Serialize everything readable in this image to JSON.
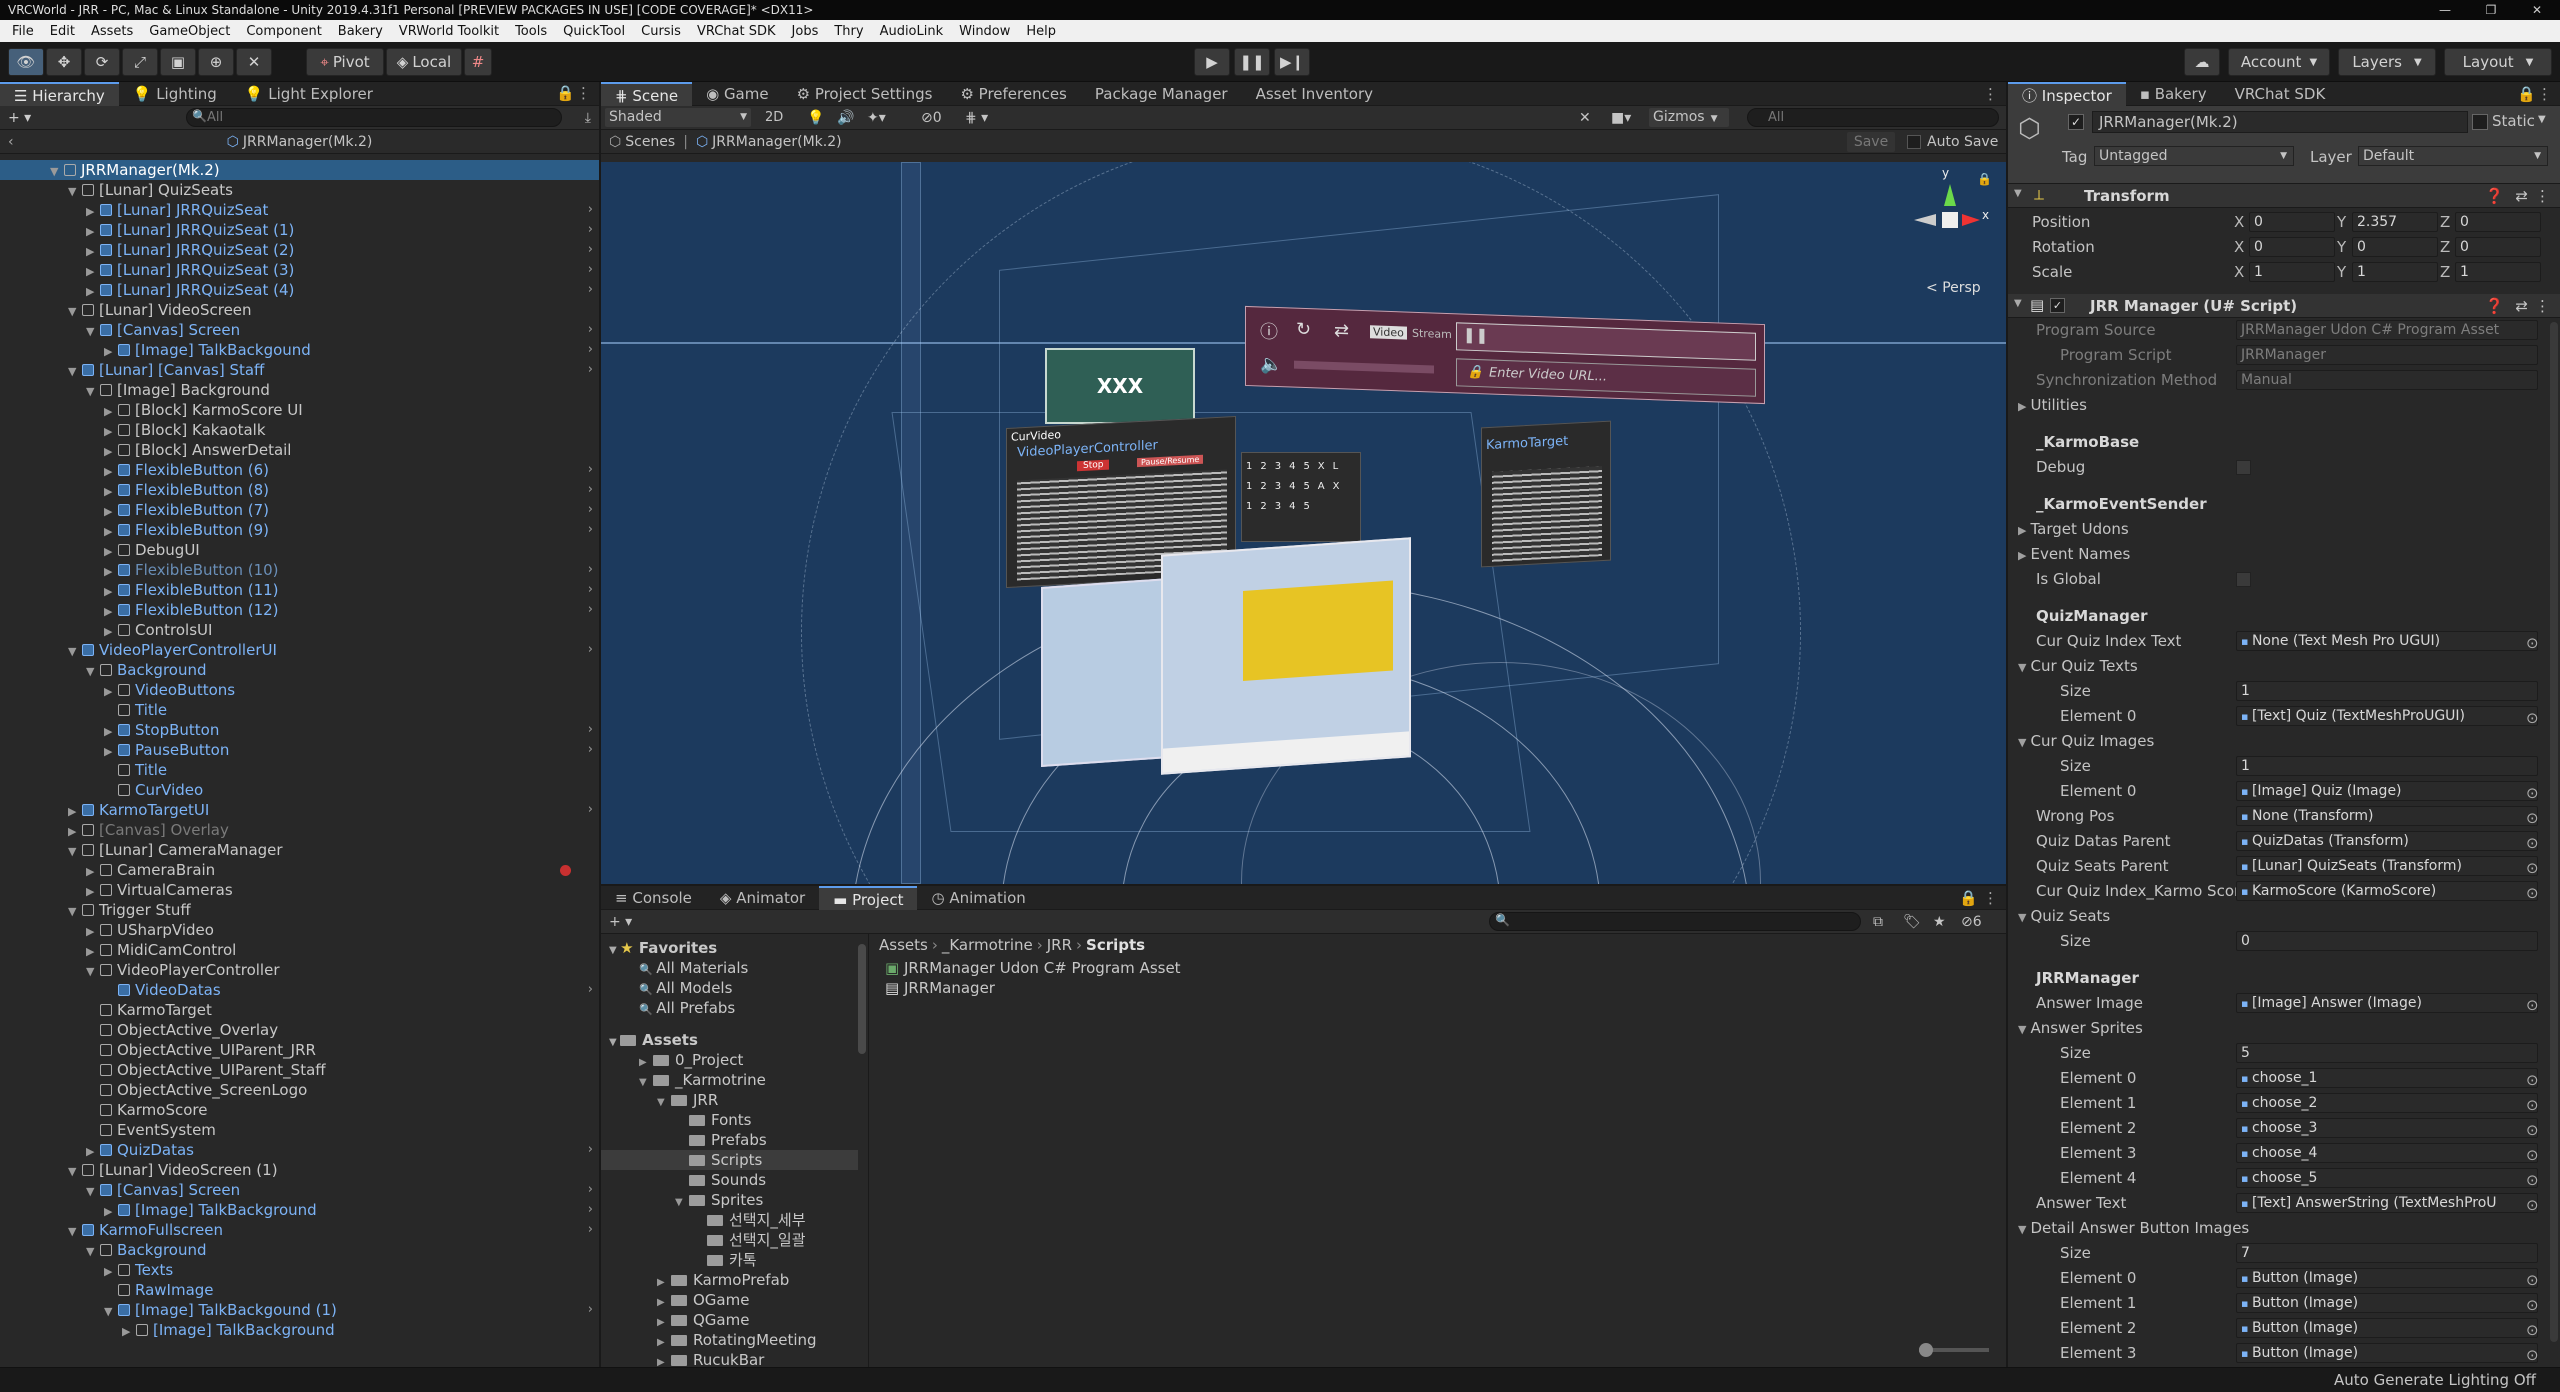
{
  "window": {
    "title": "VRCWorld - JRR - PC, Mac & Linux Standalone - Unity 2019.4.31f1 Personal [PREVIEW PACKAGES IN USE] [CODE COVERAGE]* <DX11>"
  },
  "menu": [
    "File",
    "Edit",
    "Assets",
    "GameObject",
    "Component",
    "Bakery",
    "VRWorld Toolkit",
    "Tools",
    "QuickTool",
    "Cursis",
    "VRChat SDK",
    "Jobs",
    "Thry",
    "AudioLink",
    "Window",
    "Help"
  ],
  "toolbar": {
    "pivot": "Pivot",
    "local": "Local",
    "account": "Account",
    "layers": "Layers",
    "layout": "Layout"
  },
  "hierarchy": {
    "tab_hierarchy": "Hierarchy",
    "tab_lighting": "Lighting",
    "tab_light_explorer": "Light Explorer",
    "search_placeholder": "All",
    "root": "JRRManager(Mk.2)",
    "rows": [
      {
        "label": "JRRManager(Mk.2)",
        "depth": 0,
        "style": "sel",
        "arrow": "▼",
        "icon": "cube"
      },
      {
        "label": "[Lunar] QuizSeats",
        "depth": 1,
        "style": "",
        "arrow": "▼",
        "icon": "cube"
      },
      {
        "label": "[Lunar] JRRQuizSeat",
        "depth": 2,
        "style": "blue",
        "arrow": "▶",
        "icon": "blue",
        "more": true
      },
      {
        "label": "[Lunar] JRRQuizSeat (1)",
        "depth": 2,
        "style": "blue",
        "arrow": "▶",
        "icon": "blue",
        "more": true
      },
      {
        "label": "[Lunar] JRRQuizSeat (2)",
        "depth": 2,
        "style": "blue",
        "arrow": "▶",
        "icon": "blue",
        "more": true
      },
      {
        "label": "[Lunar] JRRQuizSeat (3)",
        "depth": 2,
        "style": "blue",
        "arrow": "▶",
        "icon": "blue",
        "more": true
      },
      {
        "label": "[Lunar] JRRQuizSeat (4)",
        "depth": 2,
        "style": "blue",
        "arrow": "▶",
        "icon": "blue",
        "more": true
      },
      {
        "label": "[Lunar] VideoScreen",
        "depth": 1,
        "style": "",
        "arrow": "▼",
        "icon": "cube"
      },
      {
        "label": "[Canvas] Screen",
        "depth": 2,
        "style": "blue",
        "arrow": "▼",
        "icon": "blue",
        "more": true
      },
      {
        "label": "[Image] TalkBackgound",
        "depth": 3,
        "style": "blue",
        "arrow": "▶",
        "icon": "blue",
        "more": true
      },
      {
        "label": "[Lunar] [Canvas] Staff",
        "depth": 1,
        "style": "blue",
        "arrow": "▼",
        "icon": "blue",
        "more": true
      },
      {
        "label": "[Image] Background",
        "depth": 2,
        "style": "",
        "arrow": "▼",
        "icon": "cube"
      },
      {
        "label": "[Block] KarmoScore UI",
        "depth": 3,
        "style": "",
        "arrow": "▶",
        "icon": "cube"
      },
      {
        "label": "[Block] Kakaotalk",
        "depth": 3,
        "style": "",
        "arrow": "▶",
        "icon": "cube"
      },
      {
        "label": "[Block] AnswerDetail",
        "depth": 3,
        "style": "",
        "arrow": "▶",
        "icon": "cube"
      },
      {
        "label": "FlexibleButton (6)",
        "depth": 3,
        "style": "blue",
        "arrow": "▶",
        "icon": "blue",
        "more": true
      },
      {
        "label": "FlexibleButton (8)",
        "depth": 3,
        "style": "blue",
        "arrow": "▶",
        "icon": "blue",
        "more": true
      },
      {
        "label": "FlexibleButton (7)",
        "depth": 3,
        "style": "blue",
        "arrow": "▶",
        "icon": "blue",
        "more": true
      },
      {
        "label": "FlexibleButton (9)",
        "depth": 3,
        "style": "blue",
        "arrow": "▶",
        "icon": "blue",
        "more": true
      },
      {
        "label": "DebugUI",
        "depth": 3,
        "style": "",
        "arrow": "▶",
        "icon": "cube"
      },
      {
        "label": "FlexibleButton (10)",
        "depth": 3,
        "style": "faded",
        "arrow": "▶",
        "icon": "blue",
        "more": true
      },
      {
        "label": "FlexibleButton (11)",
        "depth": 3,
        "style": "blue",
        "arrow": "▶",
        "icon": "blue",
        "more": true
      },
      {
        "label": "FlexibleButton (12)",
        "depth": 3,
        "style": "blue",
        "arrow": "▶",
        "icon": "blue",
        "more": true
      },
      {
        "label": "ControlsUI",
        "depth": 3,
        "style": "",
        "arrow": "▶",
        "icon": "cube"
      },
      {
        "label": "VideoPlayerControllerUI",
        "depth": 1,
        "style": "blue",
        "arrow": "▼",
        "icon": "blue",
        "more": true
      },
      {
        "label": "Background",
        "depth": 2,
        "style": "blue",
        "arrow": "▼",
        "icon": "cube"
      },
      {
        "label": "VideoButtons",
        "depth": 3,
        "style": "blue",
        "arrow": "▶",
        "icon": "cube"
      },
      {
        "label": "Title",
        "depth": 3,
        "style": "blue",
        "arrow": "",
        "icon": "cube"
      },
      {
        "label": "StopButton",
        "depth": 3,
        "style": "blue",
        "arrow": "▶",
        "icon": "blue",
        "more": true
      },
      {
        "label": "PauseButton",
        "depth": 3,
        "style": "blue",
        "arrow": "▶",
        "icon": "blue",
        "more": true
      },
      {
        "label": "Title",
        "depth": 3,
        "style": "blue",
        "arrow": "",
        "icon": "cube"
      },
      {
        "label": "CurVideo",
        "depth": 3,
        "style": "blue",
        "arrow": "",
        "icon": "cube"
      },
      {
        "label": "KarmoTargetUI",
        "depth": 1,
        "style": "blue",
        "arrow": "▶",
        "icon": "blue",
        "more": true
      },
      {
        "label": "[Canvas] Overlay",
        "depth": 1,
        "style": "grey",
        "arrow": "▶",
        "icon": "cube"
      },
      {
        "label": "[Lunar] CameraManager",
        "depth": 1,
        "style": "",
        "arrow": "▼",
        "icon": "cube"
      },
      {
        "label": "CameraBrain",
        "depth": 2,
        "style": "",
        "arrow": "▶",
        "icon": "cube",
        "rec": true
      },
      {
        "label": "VirtualCameras",
        "depth": 2,
        "style": "",
        "arrow": "▶",
        "icon": "cube"
      },
      {
        "label": "Trigger Stuff",
        "depth": 1,
        "style": "",
        "arrow": "▼",
        "icon": "cube"
      },
      {
        "label": "USharpVideo",
        "depth": 2,
        "style": "",
        "arrow": "▶",
        "icon": "cube"
      },
      {
        "label": "MidiCamControl",
        "depth": 2,
        "style": "",
        "arrow": "▶",
        "icon": "cube"
      },
      {
        "label": "VideoPlayerController",
        "depth": 2,
        "style": "",
        "arrow": "▼",
        "icon": "cube"
      },
      {
        "label": "VideoDatas",
        "depth": 3,
        "style": "blue",
        "arrow": "",
        "icon": "blue",
        "more": true
      },
      {
        "label": "KarmoTarget",
        "depth": 2,
        "style": "",
        "arrow": "",
        "icon": "cube"
      },
      {
        "label": "ObjectActive_Overlay",
        "depth": 2,
        "style": "",
        "arrow": "",
        "icon": "cube"
      },
      {
        "label": "ObjectActive_UIParent_JRR",
        "depth": 2,
        "style": "",
        "arrow": "",
        "icon": "cube"
      },
      {
        "label": "ObjectActive_UIParent_Staff",
        "depth": 2,
        "style": "",
        "arrow": "",
        "icon": "cube"
      },
      {
        "label": "ObjectActive_ScreenLogo",
        "depth": 2,
        "style": "",
        "arrow": "",
        "icon": "cube"
      },
      {
        "label": "KarmoScore",
        "depth": 2,
        "style": "",
        "arrow": "",
        "icon": "cube"
      },
      {
        "label": "EventSystem",
        "depth": 2,
        "style": "",
        "arrow": "",
        "icon": "cube"
      },
      {
        "label": "QuizDatas",
        "depth": 2,
        "style": "blue",
        "arrow": "▶",
        "icon": "blue",
        "more": true
      },
      {
        "label": "[Lunar] VideoScreen (1)",
        "depth": 1,
        "style": "",
        "arrow": "▼",
        "icon": "cube"
      },
      {
        "label": "[Canvas] Screen",
        "depth": 2,
        "style": "blue",
        "arrow": "▼",
        "icon": "blue",
        "more": true
      },
      {
        "label": "[Image] TalkBackground",
        "depth": 3,
        "style": "blue",
        "arrow": "▶",
        "icon": "blue",
        "more": true
      },
      {
        "label": "KarmoFullscreen",
        "depth": 1,
        "style": "blue",
        "arrow": "▼",
        "icon": "blue",
        "more": true
      },
      {
        "label": "Background",
        "depth": 2,
        "style": "blue",
        "arrow": "▼",
        "icon": "cube"
      },
      {
        "label": "Texts",
        "depth": 3,
        "style": "blue",
        "arrow": "▶",
        "icon": "cube"
      },
      {
        "label": "RawImage",
        "depth": 3,
        "style": "blue",
        "arrow": "",
        "icon": "cube"
      },
      {
        "label": "[Image] TalkBackgound (1)",
        "depth": 3,
        "style": "blue",
        "arrow": "▼",
        "icon": "blue",
        "more": true
      },
      {
        "label": "[Image] TalkBackground",
        "depth": 4,
        "style": "blue",
        "arrow": "▶",
        "icon": "cube"
      }
    ]
  },
  "scene": {
    "tabs": [
      "Scene",
      "Game",
      "Project Settings",
      "Preferences",
      "Package Manager",
      "Asset Inventory"
    ],
    "shading": "Shaded",
    "mode2d": "2D",
    "hidden_count": "0",
    "gizmos": "Gizmos",
    "search_placeholder": "All",
    "breadcrumb_scenes": "Scenes",
    "breadcrumb_object": "JRRManager(Mk.2)",
    "save": "Save",
    "auto_save": "Auto Save",
    "persp": "Persp",
    "axis_y": "y",
    "axis_x": "x",
    "overlay": {
      "xxx": "XXX",
      "video": "Video",
      "stream": "Stream",
      "enter_url": "Enter Video URL...",
      "cur_video": "CurVideo",
      "vpc": "VideoPlayerController",
      "karmo_target": "KarmoTarget",
      "stop": "Stop",
      "pause": "Pause/Resume"
    }
  },
  "bottom": {
    "tabs": [
      "Console",
      "Animator",
      "Project",
      "Animation"
    ],
    "favorites": {
      "title": "Favorites",
      "items": [
        "All Materials",
        "All Models",
        "All Prefabs"
      ]
    },
    "assets_title": "Assets",
    "tree": [
      {
        "label": "0_Project",
        "depth": 1,
        "arrow": "▶"
      },
      {
        "label": "_Karmotrine",
        "depth": 1,
        "arrow": "▼"
      },
      {
        "label": "JRR",
        "depth": 2,
        "arrow": "▼"
      },
      {
        "label": "Fonts",
        "depth": 3,
        "arrow": ""
      },
      {
        "label": "Prefabs",
        "depth": 3,
        "arrow": ""
      },
      {
        "label": "Scripts",
        "depth": 3,
        "arrow": "",
        "sel": true
      },
      {
        "label": "Sounds",
        "depth": 3,
        "arrow": ""
      },
      {
        "label": "Sprites",
        "depth": 3,
        "arrow": "▼"
      },
      {
        "label": "선택지_세부",
        "depth": 4,
        "arrow": ""
      },
      {
        "label": "선택지_일괄",
        "depth": 4,
        "arrow": ""
      },
      {
        "label": "카톡",
        "depth": 4,
        "arrow": ""
      },
      {
        "label": "KarmoPrefab",
        "depth": 2,
        "arrow": "▶"
      },
      {
        "label": "OGame",
        "depth": 2,
        "arrow": "▶"
      },
      {
        "label": "QGame",
        "depth": 2,
        "arrow": "▶"
      },
      {
        "label": "RotatingMeeting",
        "depth": 2,
        "arrow": "▶"
      },
      {
        "label": "RucukBar",
        "depth": 2,
        "arrow": "▶"
      }
    ],
    "breadcrumb": [
      "Assets",
      "_Karmotrine",
      "JRR",
      "Scripts"
    ],
    "files": [
      "JRRManager Udon C# Program Asset",
      "JRRManager"
    ],
    "hidden_count": "6"
  },
  "inspector": {
    "tabs": [
      "Inspector",
      "Bakery",
      "VRChat SDK"
    ],
    "object_name": "JRRManager(Mk.2)",
    "static": "Static",
    "tag_label": "Tag",
    "tag_value": "Untagged",
    "layer_label": "Layer",
    "layer_value": "Default",
    "transform": {
      "title": "Transform",
      "rows": [
        {
          "label": "Position",
          "x": "0",
          "y": "2.357",
          "z": "0"
        },
        {
          "label": "Rotation",
          "x": "0",
          "y": "0",
          "z": "0"
        },
        {
          "label": "Scale",
          "x": "1",
          "y": "1",
          "z": "1"
        }
      ]
    },
    "component_title": "JRR Manager (U# Script)",
    "fields": [
      {
        "label": "Program Source",
        "value": "JRRManager Udon C# Program Asset",
        "dim": true
      },
      {
        "label": "Program Script",
        "value": "JRRManager",
        "dim": true,
        "indent": true
      },
      {
        "label": "Synchronization Method",
        "value": "Manual",
        "dim": true
      },
      {
        "label": "Utilities",
        "fold": "▶"
      },
      {
        "label": "",
        "gap": true
      },
      {
        "label": "_KarmoBase",
        "section": true
      },
      {
        "label": "Debug",
        "check": true
      },
      {
        "label": "",
        "gap": true
      },
      {
        "label": "_KarmoEventSender",
        "section": true
      },
      {
        "label": "Target Udons",
        "fold": "▶"
      },
      {
        "label": "Event Names",
        "fold": "▶"
      },
      {
        "label": "Is Global",
        "check": true
      },
      {
        "label": "",
        "gap": true
      },
      {
        "label": "QuizManager",
        "section": true
      },
      {
        "label": "Cur Quiz Index Text",
        "value": "None (Text Mesh Pro UGUI)",
        "pick": true
      },
      {
        "label": "Cur Quiz Texts",
        "fold": "▼"
      },
      {
        "label": "Size",
        "value": "1",
        "indent": true
      },
      {
        "label": "Element 0",
        "value": "[Text] Quiz (TextMeshProUGUI)",
        "indent": true,
        "pick": true
      },
      {
        "label": "Cur Quiz Images",
        "fold": "▼"
      },
      {
        "label": "Size",
        "value": "1",
        "indent": true
      },
      {
        "label": "Element 0",
        "value": "[Image] Quiz (Image)",
        "indent": true,
        "pick": true
      },
      {
        "label": "Wrong Pos",
        "value": "None (Transform)",
        "pick": true
      },
      {
        "label": "Quiz Datas Parent",
        "value": "QuizDatas (Transform)",
        "pick": true
      },
      {
        "label": "Quiz Seats Parent",
        "value": "[Lunar] QuizSeats (Transform)",
        "pick": true
      },
      {
        "label": "Cur Quiz Index_Karmo Score",
        "value": "KarmoScore (KarmoScore)",
        "pick": true
      },
      {
        "label": "Quiz Seats",
        "fold": "▼"
      },
      {
        "label": "Size",
        "value": "0",
        "indent": true
      },
      {
        "label": "",
        "gap": true
      },
      {
        "label": "JRRManager",
        "section": true
      },
      {
        "label": "Answer Image",
        "value": "[Image] Answer (Image)",
        "pick": true
      },
      {
        "label": "Answer Sprites",
        "fold": "▼"
      },
      {
        "label": "Size",
        "value": "5",
        "indent": true
      },
      {
        "label": "Element 0",
        "value": "choose_1",
        "indent": true,
        "pick": true
      },
      {
        "label": "Element 1",
        "value": "choose_2",
        "indent": true,
        "pick": true
      },
      {
        "label": "Element 2",
        "value": "choose_3",
        "indent": true,
        "pick": true
      },
      {
        "label": "Element 3",
        "value": "choose_4",
        "indent": true,
        "pick": true
      },
      {
        "label": "Element 4",
        "value": "choose_5",
        "indent": true,
        "pick": true
      },
      {
        "label": "Answer Text",
        "value": "[Text] AnswerString (TextMeshProU",
        "pick": true
      },
      {
        "label": "Detail Answer Button Images",
        "fold": "▼"
      },
      {
        "label": "Size",
        "value": "7",
        "indent": true
      },
      {
        "label": "Element 0",
        "value": "Button (Image)",
        "indent": true,
        "pick": true
      },
      {
        "label": "Element 1",
        "value": "Button (Image)",
        "indent": true,
        "pick": true
      },
      {
        "label": "Element 2",
        "value": "Button (Image)",
        "indent": true,
        "pick": true
      },
      {
        "label": "Element 3",
        "value": "Button (Image)",
        "indent": true,
        "pick": true
      }
    ]
  },
  "status": {
    "right": "Auto Generate Lighting Off"
  }
}
